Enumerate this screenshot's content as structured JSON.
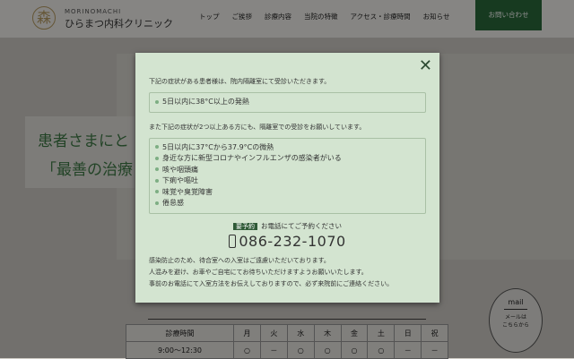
{
  "header": {
    "logo_sub": "MORINOMACHI",
    "logo_name": "ひらまつ内科クリニック",
    "logo_mark": "森",
    "nav": [
      "トップ",
      "ご挨拶",
      "診療内容",
      "当院の特徴",
      "アクセス・診療時間",
      "お知らせ"
    ],
    "contact": "お問い合わせ"
  },
  "hero": {
    "line1": "患者さまにと",
    "line2": "「最善の治療"
  },
  "hours": {
    "headers": [
      "診療時間",
      "月",
      "火",
      "水",
      "木",
      "金",
      "土",
      "日",
      "祝"
    ],
    "row1": [
      "9:00～12:30",
      "○",
      "－",
      "○",
      "○",
      "○",
      "○",
      "－",
      "－"
    ]
  },
  "mail": {
    "title": "mail",
    "line1": "メールは",
    "line2": "こちらから"
  },
  "modal": {
    "close": "✕",
    "intro1": "下記の症状がある患者様は、院内隔離室にて受診いただきます。",
    "list1": [
      "5日以内に38°C以上の発熱"
    ],
    "intro2": "また下記の症状が2つ以上ある方にも、隔離室での受診をお願いしています。",
    "list2": [
      "5日以内に37°Cから37.9°Cの微熱",
      "身近な方に新型コロナやインフルエンザの感染者がいる",
      "咳や咽頭痛",
      "下痢や嘔吐",
      "味覚や臭覚障害",
      "倦怠感"
    ],
    "badge": "要予約",
    "reserve": "お電話にてご予約ください",
    "phone": "086-232-1070",
    "notes": [
      "感染防止のため、待合室への入室はご遠慮いただいております。",
      "人混みを避け、お車やご自宅にてお待ちいただけますようお願いいたします。",
      "事前のお電話にて入室方法をお伝えしておりますので、必ず来院前にご連絡ください。"
    ]
  }
}
